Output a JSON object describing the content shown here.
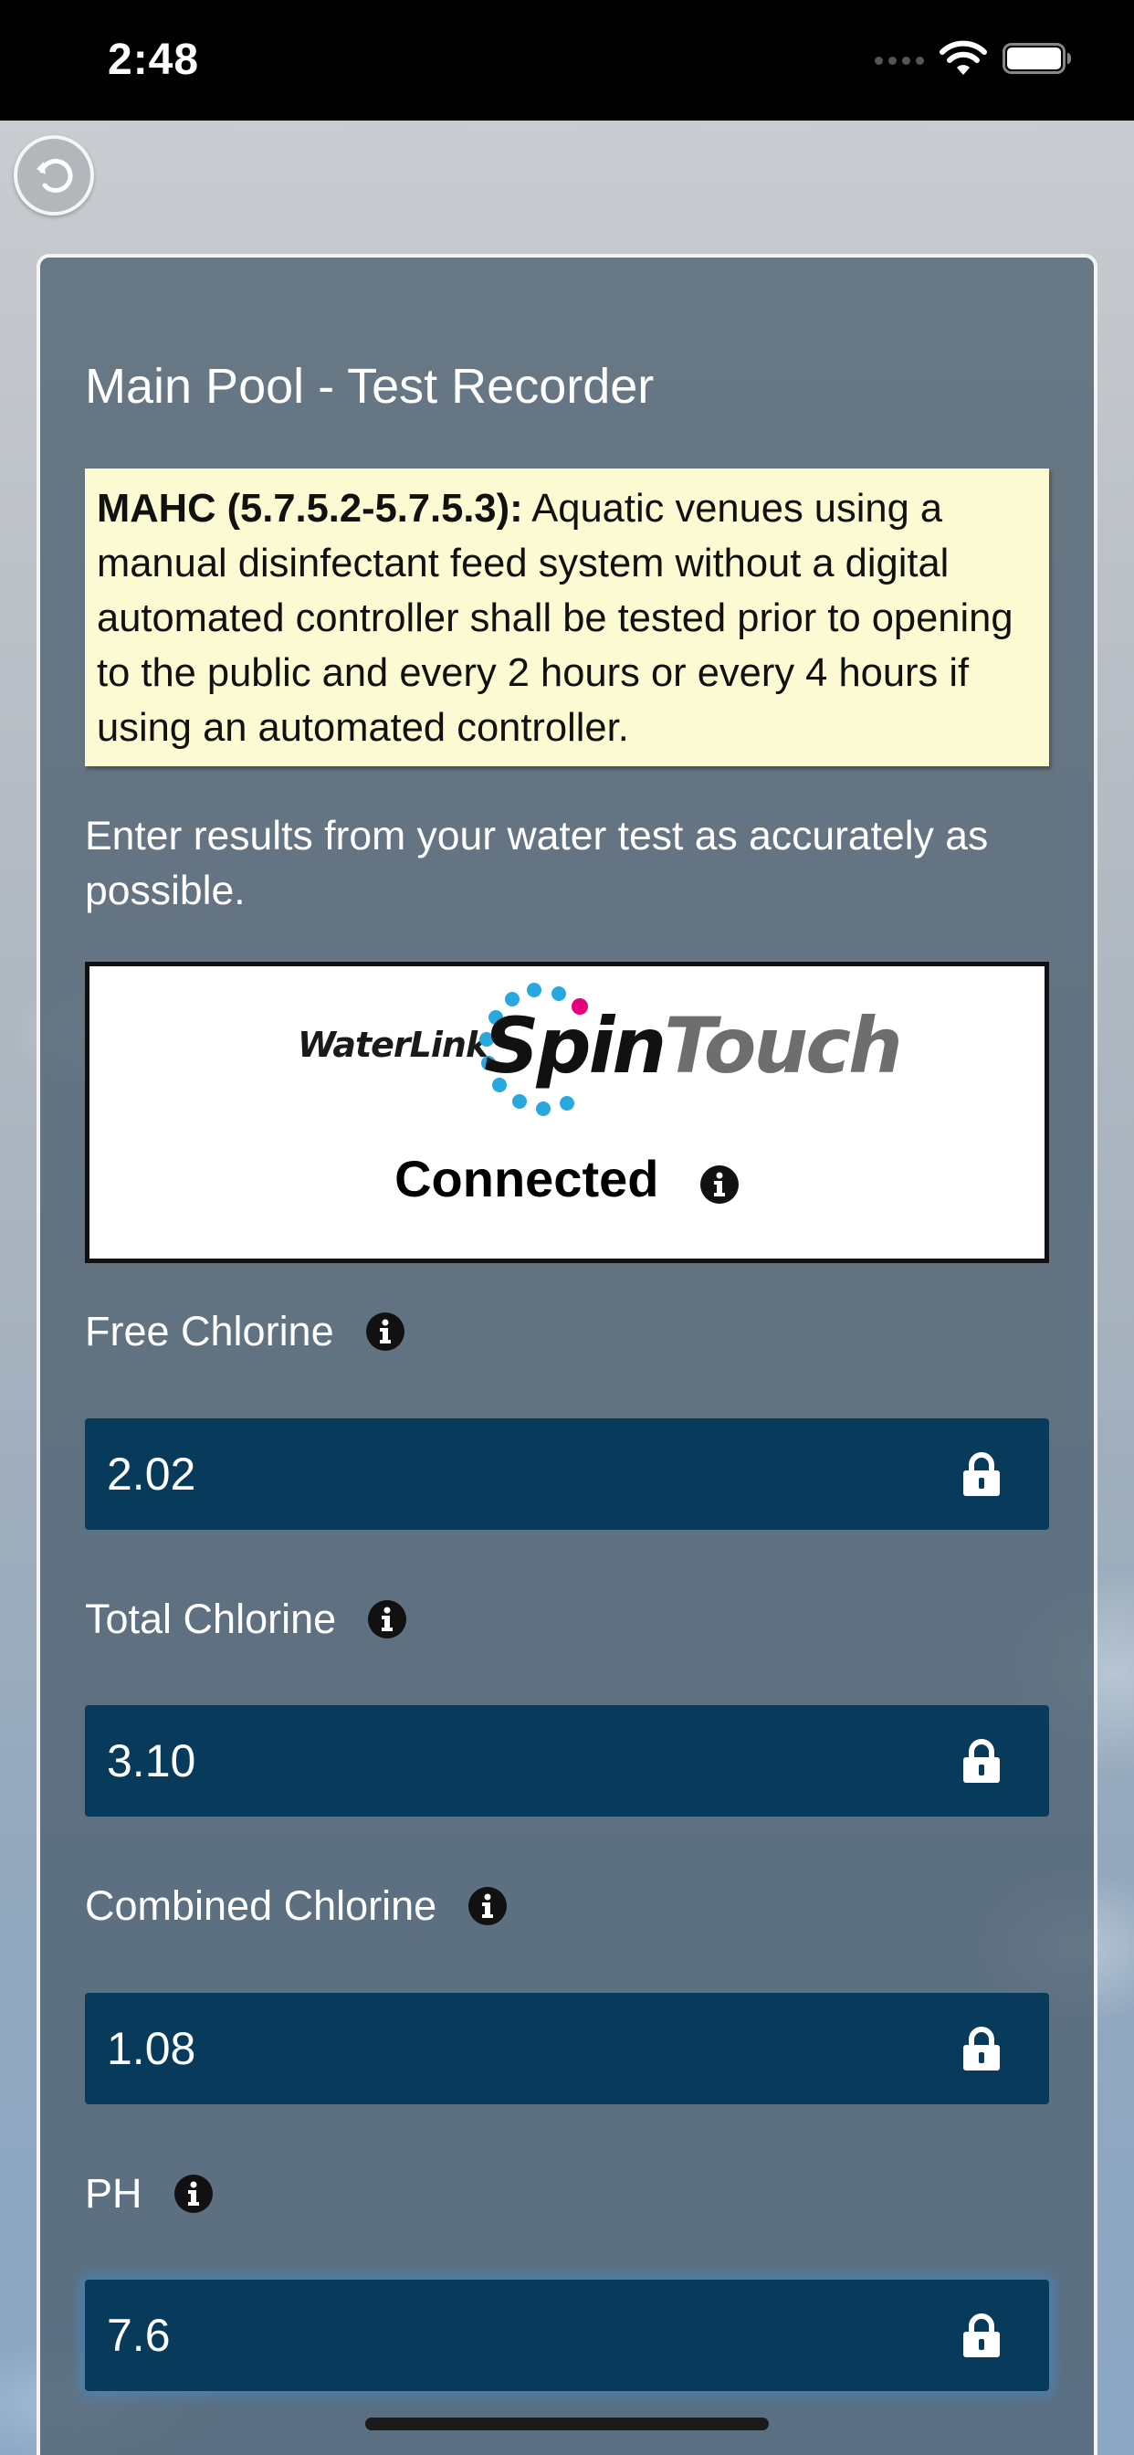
{
  "status_bar": {
    "time": "2:48"
  },
  "header": {
    "back_icon": "undo-arrow-icon"
  },
  "page": {
    "title": "Main Pool - Test Recorder",
    "notice": {
      "code": "MAHC (5.7.5.2-5.7.5.3):",
      "text": " Aquatic venues using a manual disinfectant feed system without a digital automated controller shall be tested prior to opening to the public and every 2 hours or every 4 hours if using an automated controller."
    },
    "instructions": "Enter results from your water test as accurately as possible."
  },
  "device_panel": {
    "brand_prefix": "WaterLink",
    "brand_spin": "Spin",
    "brand_touch": "Touch",
    "status": "Connected",
    "info_icon": "info-icon"
  },
  "fields": [
    {
      "label": "Free Chlorine",
      "value": "2.02",
      "locked": true
    },
    {
      "label": "Total Chlorine",
      "value": "3.10",
      "locked": true
    },
    {
      "label": "Combined Chlorine",
      "value": "1.08",
      "locked": true
    },
    {
      "label": "PH",
      "value": "7.6",
      "locked": true
    }
  ],
  "colors": {
    "input_background": "#073a5b",
    "notice_background": "#fbfad2",
    "card_background": "#4e6070"
  }
}
